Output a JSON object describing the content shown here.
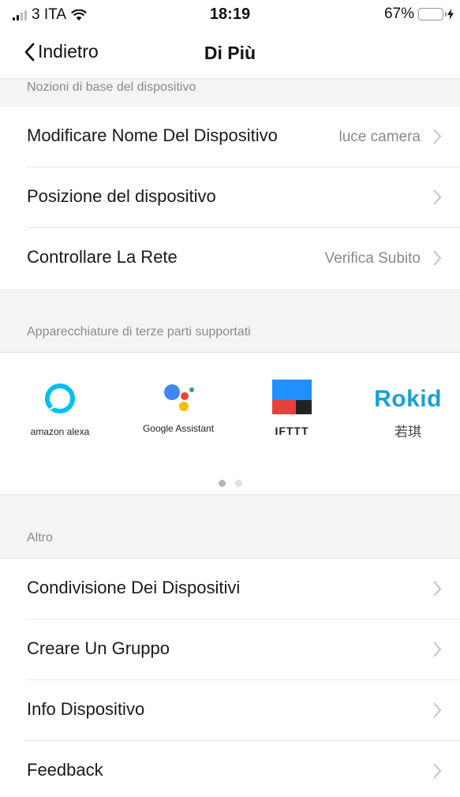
{
  "status_bar": {
    "carrier": "3 ITA",
    "time": "18:19",
    "battery": "67%",
    "battery_level": 0.67
  },
  "nav": {
    "back_label": "Indietro",
    "title": "Di Più"
  },
  "sections": {
    "basics": {
      "header": "Nozioni di base del dispositivo",
      "rows": [
        {
          "label": "Modificare Nome Del Dispositivo",
          "value": "luce camera"
        },
        {
          "label": "Posizione del dispositivo",
          "value": ""
        },
        {
          "label": "Controllare La Rete",
          "value": "Verifica Subito"
        }
      ]
    },
    "third_party": {
      "header": "Apparecchiature di terze parti supportati",
      "items": [
        {
          "name": "amazon alexa",
          "icon": "alexa-icon"
        },
        {
          "name": "Google Assistant",
          "icon": "google-assistant-icon"
        },
        {
          "name": "IFTTT",
          "icon": "ifttt-icon"
        },
        {
          "name": "若琪",
          "logo_text": "Rokid",
          "icon": "rokid-icon"
        }
      ],
      "pages": 2,
      "current_page": 1
    },
    "other": {
      "header": "Altro",
      "rows": [
        {
          "label": "Condivisione Dei Dispositivi"
        },
        {
          "label": "Creare Un Gruppo"
        },
        {
          "label": "Info Dispositivo"
        },
        {
          "label": "Feedback"
        }
      ]
    }
  },
  "colors": {
    "alexa": "#00c0f0",
    "battery_fill": "#4cd964",
    "rokid": "#1a9fd8",
    "ifttt_blue": "#1e90ff",
    "ifttt_red": "#e8403b",
    "ifttt_black": "#222222"
  }
}
